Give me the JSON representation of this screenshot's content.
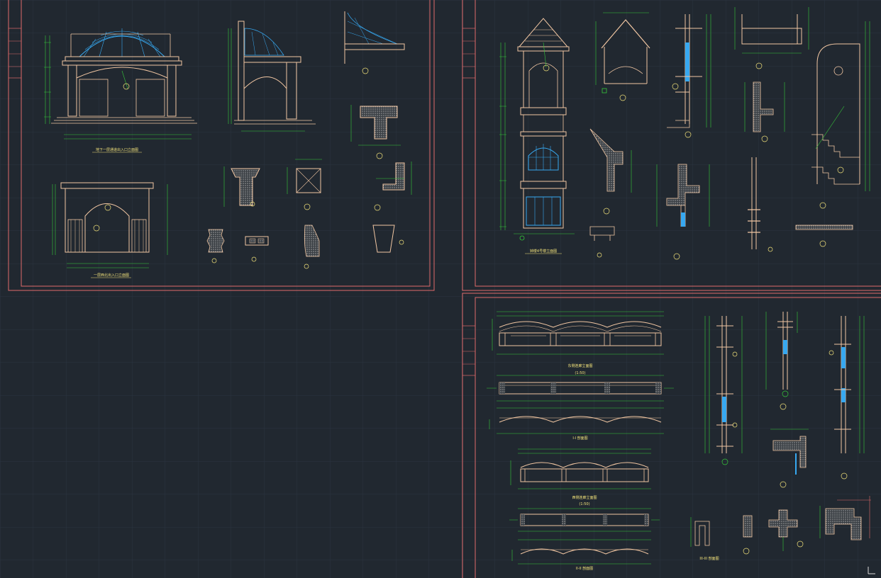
{
  "viewport": {
    "background": "#212830",
    "grid_color": "#2b3440"
  },
  "colors": {
    "frame": "#e06a6a",
    "dimension": "#36c93a",
    "structure": "#f1c6a2",
    "glass": "#37a8f0",
    "label": "#f2e27a",
    "callout": "#f2e27a"
  },
  "sheets": [
    {
      "name": "sheet-entrance"
    },
    {
      "name": "sheet-tower"
    },
    {
      "name": "sheet-colonnade"
    }
  ],
  "captions": {
    "entrance_elevation": "地下一层通道出入口立面图",
    "gate_elevation": "一层西北出入口立面图",
    "tower_elevation": "钟楼4号楼立面图",
    "colonnade_elev1": "东侧连廊立面图",
    "colonnade_elev1_sub": "(1:50)",
    "section_1": "I-I 剖面图",
    "colonnade_elev2": "西侧连廊立面图",
    "colonnade_elev2_sub": "(1:50)",
    "section_2": "II-II 剖面图",
    "section_3": "III-III 剖面图"
  },
  "icons": {
    "ucs": "ucs-axis-icon"
  }
}
